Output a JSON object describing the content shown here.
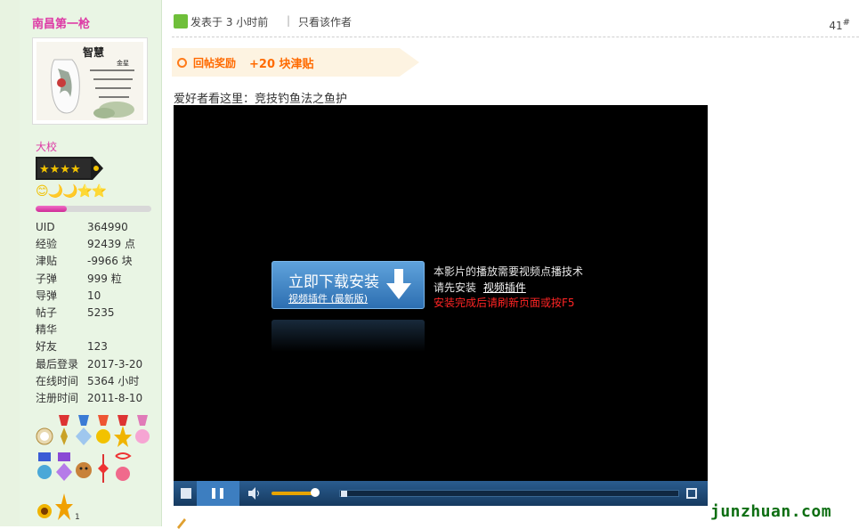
{
  "sidebar": {
    "username": "南昌第一枪",
    "rank_title": "大校",
    "rank_icons": "😊🌙🌙⭐⭐",
    "credit_progress": 0.27,
    "stats": [
      {
        "label": "UID",
        "value": "364990"
      },
      {
        "label": "经验",
        "value": "92439 点"
      },
      {
        "label": "津贴",
        "value": "-9966 块"
      },
      {
        "label": "子弹",
        "value": "999 粒"
      },
      {
        "label": "导弹",
        "value": "10"
      },
      {
        "label": "帖子",
        "value": "5235"
      },
      {
        "label": "精华",
        "value": ""
      },
      {
        "label": "好友",
        "value": "123"
      },
      {
        "label": "最后登录",
        "value": "2017-3-20"
      },
      {
        "label": "在线时间",
        "value": "5364 小时"
      },
      {
        "label": "注册时间",
        "value": "2011-8-10"
      }
    ],
    "medal_count_badge": "1"
  },
  "post": {
    "posted": "发表于 3 小时前",
    "separator": "|",
    "only_author": "只看该作者",
    "floor": "41",
    "floor_suffix": "#",
    "reward_label": "回帖奖励",
    "reward_amount": "+20 块津贴",
    "headline": "爱好者看这里：竞技钓鱼法之鱼护"
  },
  "player": {
    "download_big": "立即下载安装",
    "download_small": "视频插件 (最新版)",
    "info_line1": "本影片的播放需要视频点播技术",
    "info_line2_prefix": "请先安装",
    "info_line2_link": "视频插件",
    "info_line3": "安装完成后请刷新页面或按F5",
    "volume_level": 0.85,
    "seek_position": 0.0
  },
  "watermark": "junzhuan.com",
  "colors": {
    "accent_pink": "#dd3aa5",
    "reward_orange": "#ff6a00",
    "player_blue": "#2a5c8f",
    "watermark_green": "#0d6e12"
  }
}
